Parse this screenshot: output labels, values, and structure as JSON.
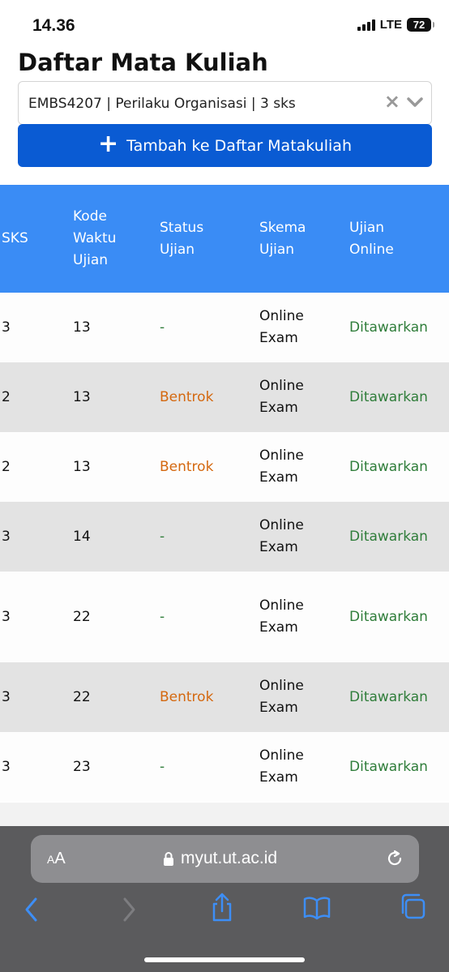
{
  "status_bar": {
    "time": "14.36",
    "network": "LTE",
    "battery": "72"
  },
  "header": {
    "title": "Daftar Mata Kuliah",
    "selected_course": "EMBS4207 | Perilaku Organisasi | 3 sks",
    "clear_symbol": "×",
    "add_button_plus": "+",
    "add_button_label": "Tambah ke Daftar Matakuliah"
  },
  "table": {
    "headers": {
      "sks": "SKS",
      "kode_line1": "Kode",
      "kode_line2": "Waktu",
      "kode_line3": "Ujian",
      "status_line1": "Status",
      "status_line2": "Ujian",
      "skema_line1": "Skema",
      "skema_line2": "Ujian",
      "online_line1": "Ujian",
      "online_line2": "Online"
    },
    "rows": [
      {
        "sks": "3",
        "kode": "13",
        "status": "-",
        "skema_line1": "Online",
        "skema_line2": "Exam",
        "online": "Ditawarkan"
      },
      {
        "sks": "2",
        "kode": "13",
        "status": "Bentrok",
        "skema_line1": "Online",
        "skema_line2": "Exam",
        "online": "Ditawarkan"
      },
      {
        "sks": "2",
        "kode": "13",
        "status": "Bentrok",
        "skema_line1": "Online",
        "skema_line2": "Exam",
        "online": "Ditawarkan"
      },
      {
        "sks": "3",
        "kode": "14",
        "status": "-",
        "skema_line1": "Online",
        "skema_line2": "Exam",
        "online": "Ditawarkan"
      },
      {
        "sks": "3",
        "kode": "22",
        "status": "-",
        "skema_line1": "Online",
        "skema_line2": "Exam",
        "online": "Ditawarkan"
      },
      {
        "sks": "3",
        "kode": "22",
        "status": "Bentrok",
        "skema_line1": "Online",
        "skema_line2": "Exam",
        "online": "Ditawarkan"
      },
      {
        "sks": "3",
        "kode": "23",
        "status": "-",
        "skema_line1": "Online",
        "skema_line2": "Exam",
        "online": "Ditawarkan"
      }
    ]
  },
  "browser": {
    "aa_small": "A",
    "aa_large": "A",
    "url": "myut.ut.ac.id"
  },
  "colors": {
    "primary_button": "#0a5bd3",
    "table_header": "#3a8cf5",
    "status_conflict": "#d4680f",
    "status_offered": "#2f7d3a"
  }
}
